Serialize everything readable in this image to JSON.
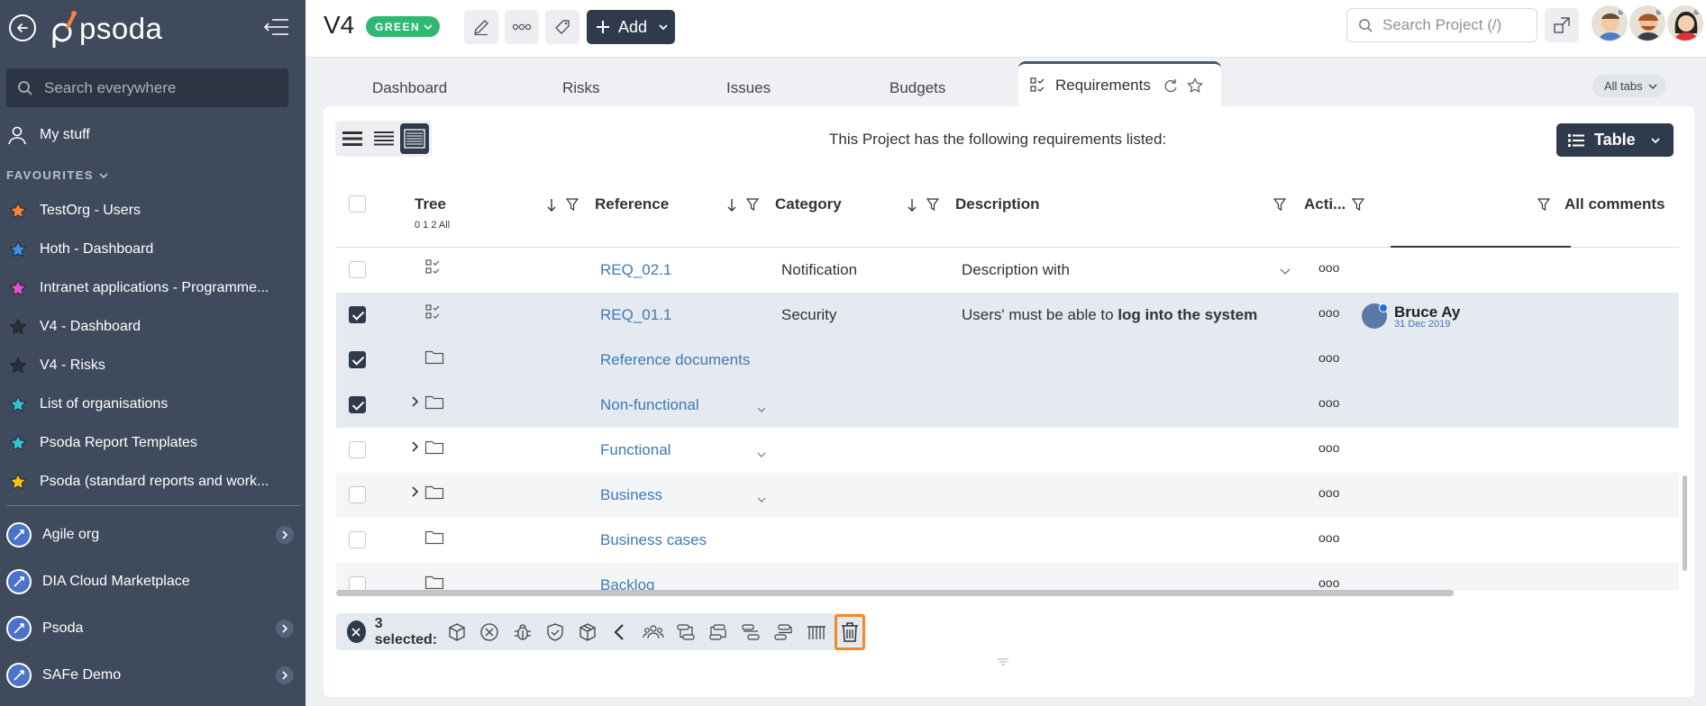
{
  "sidebar": {
    "logo_text": "psoda",
    "search_placeholder": "Search everywhere",
    "my_stuff": "My stuff",
    "favourites_header": "FAVOURITES",
    "favourites": [
      {
        "label": "TestOrg - Users",
        "color": "#f5843c"
      },
      {
        "label": "Hoth - Dashboard",
        "color": "#3b8fe8"
      },
      {
        "label": "Intranet applications - Programme...",
        "color": "#e64fd1"
      },
      {
        "label": "V4 - Dashboard",
        "color": "#2a2f38"
      },
      {
        "label": "V4 - Risks",
        "color": "#2a2f38"
      },
      {
        "label": "List of organisations",
        "color": "#2ec4d6"
      },
      {
        "label": "Psoda Report Templates",
        "color": "#2ec4d6"
      },
      {
        "label": "Psoda (standard reports and work...",
        "color": "#f0c419"
      }
    ],
    "orgs": [
      {
        "label": "Agile org",
        "has_children": true
      },
      {
        "label": "DIA Cloud Marketplace",
        "has_children": false
      },
      {
        "label": "Psoda",
        "has_children": true
      },
      {
        "label": "SAFe Demo",
        "has_children": true
      }
    ]
  },
  "topbar": {
    "project_title": "V4",
    "status": "GREEN",
    "add_label": "Add",
    "search_placeholder": "Search Project (/)"
  },
  "tabs": {
    "items": [
      "Dashboard",
      "Risks",
      "Issues",
      "Budgets"
    ],
    "active": "Requirements",
    "all_tabs": "All tabs"
  },
  "panel": {
    "message": "This Project has the following requirements listed:",
    "view_button": "Table"
  },
  "table": {
    "headers": {
      "tree": "Tree",
      "levels": "0 1 2 All",
      "reference": "Reference",
      "category": "Category",
      "description": "Description",
      "actions": "Acti...",
      "comments": "All comments"
    },
    "rows": [
      {
        "checked": false,
        "type": "req",
        "reference": "REQ_02.1",
        "category": "Notification",
        "description": "Description with",
        "expandable": false,
        "has_desc_chevron": true
      },
      {
        "checked": true,
        "type": "req",
        "reference": "REQ_01.1",
        "category": "Security",
        "description_plain": "Users' must be able to ",
        "description_bold": "log into the system",
        "expandable": false
      },
      {
        "checked": true,
        "type": "folder",
        "reference": "Reference documents",
        "expandable": false
      },
      {
        "checked": true,
        "type": "folder",
        "reference": "Non-functional",
        "expandable": true
      },
      {
        "checked": false,
        "type": "folder",
        "reference": "Functional",
        "expandable": true
      },
      {
        "checked": false,
        "type": "folder",
        "reference": "Business",
        "expandable": true
      },
      {
        "checked": false,
        "type": "folder",
        "reference": "Business cases",
        "expandable": false
      },
      {
        "checked": false,
        "type": "folder",
        "reference": "Backlog",
        "expandable": false
      }
    ],
    "comment": {
      "name": "Bruce Ay",
      "date": "31 Dec 2019"
    },
    "actions_glyph": "ooo"
  },
  "selection_bar": {
    "count_text": "3 selected:"
  },
  "colors": {
    "sidebar_bg": "#3f4a5c",
    "dark_button": "#2f3b4d",
    "status_green": "#2eb872",
    "link": "#3d7ab8",
    "highlight": "#f08a24"
  }
}
